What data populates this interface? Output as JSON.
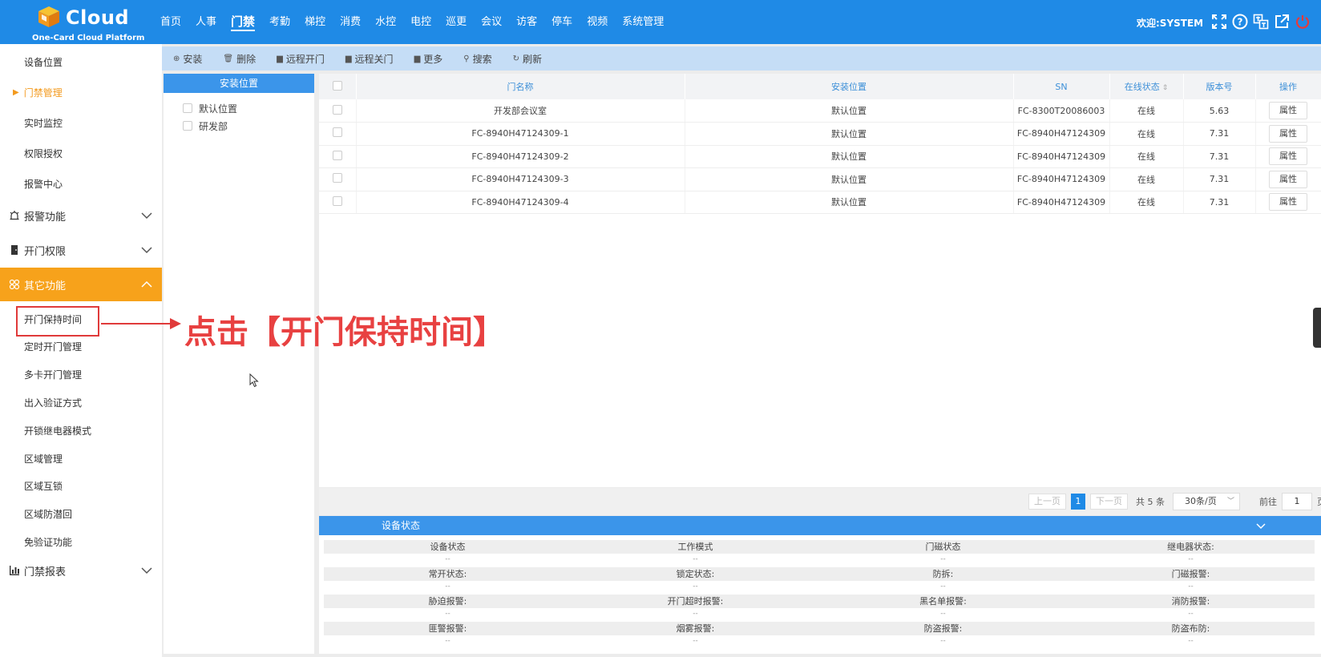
{
  "header": {
    "logo_title": "Cloud",
    "logo_subtitle": "One-Card Cloud Platform",
    "nav": [
      "首页",
      "人事",
      "门禁",
      "考勤",
      "梯控",
      "消费",
      "水控",
      "电控",
      "巡更",
      "会议",
      "访客",
      "停车",
      "视频",
      "系统管理"
    ],
    "active_nav": "门禁",
    "welcome": "欢迎:SYSTEM"
  },
  "sidebar": {
    "items_top": [
      "设备位置",
      "门禁管理",
      "实时监控",
      "权限授权",
      "报警中心"
    ],
    "current_item": "门禁管理",
    "groups": {
      "alarm": "报警功能",
      "door_perm": "开门权限",
      "other": "其它功能",
      "report": "门禁报表"
    },
    "other_items": [
      "开门保持时间",
      "定时开门管理",
      "多卡开门管理",
      "出入验证方式",
      "开锁继电器模式",
      "区域管理",
      "区域互锁",
      "区域防潜回",
      "免验证功能"
    ]
  },
  "toolbar": {
    "install": "安装",
    "delete": "删除",
    "remote_open": "远程开门",
    "remote_close": "远程关门",
    "more": "更多",
    "search": "搜索",
    "refresh": "刷新"
  },
  "location_panel": {
    "title": "安装位置",
    "items": [
      "默认位置",
      "研发部"
    ]
  },
  "device_table": {
    "columns": [
      "门名称",
      "安装位置",
      "SN",
      "在线状态",
      "版本号",
      "操作"
    ],
    "rows": [
      {
        "name": "开发部会议室",
        "location": "默认位置",
        "sn": "FC-8300T20086003",
        "status": "在线",
        "version": "5.63",
        "action": "属性"
      },
      {
        "name": "FC-8940H47124309-1",
        "location": "默认位置",
        "sn": "FC-8940H47124309",
        "status": "在线",
        "version": "7.31",
        "action": "属性"
      },
      {
        "name": "FC-8940H47124309-2",
        "location": "默认位置",
        "sn": "FC-8940H47124309",
        "status": "在线",
        "version": "7.31",
        "action": "属性"
      },
      {
        "name": "FC-8940H47124309-3",
        "location": "默认位置",
        "sn": "FC-8940H47124309",
        "status": "在线",
        "version": "7.31",
        "action": "属性"
      },
      {
        "name": "FC-8940H47124309-4",
        "location": "默认位置",
        "sn": "FC-8940H47124309",
        "status": "在线",
        "version": "7.31",
        "action": "属性"
      }
    ]
  },
  "pagination": {
    "prev": "上一页",
    "current": "1",
    "next": "下一页",
    "total": "共 5 条",
    "page_size": "30条/页",
    "goto_label": "前往",
    "goto_value": "1",
    "page_label": "页"
  },
  "status_panel": {
    "title": "设备状态",
    "rows": [
      {
        "labels": [
          "设备状态",
          "工作模式",
          "门磁状态",
          "继电器状态:"
        ],
        "values": [
          "--",
          "--",
          "--",
          "--"
        ]
      },
      {
        "labels": [
          "常开状态:",
          "锁定状态:",
          "防拆:",
          "门磁报警:"
        ],
        "values": [
          "--",
          "--",
          "--",
          "--"
        ]
      },
      {
        "labels": [
          "胁迫报警:",
          "开门超时报警:",
          "黑名单报警:",
          "消防报警:"
        ],
        "values": [
          "--",
          "--",
          "--",
          "--"
        ]
      },
      {
        "labels": [
          "匪警报警:",
          "烟雾报警:",
          "防盗报警:",
          "防盗布防:"
        ],
        "values": [
          "--",
          "--",
          "--",
          "--"
        ]
      }
    ]
  },
  "annotation": {
    "text": "点击【开门保持时间】"
  }
}
